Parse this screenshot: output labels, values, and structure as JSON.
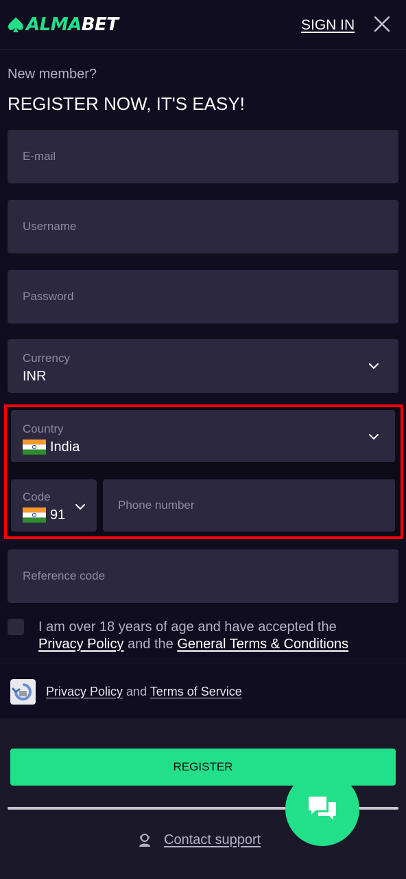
{
  "header": {
    "logo_part1": "ALMA",
    "logo_part2": "BET",
    "signin_label": "SIGN IN",
    "close_icon": "close-icon"
  },
  "intro": {
    "new_member": "New member?",
    "headline": "REGISTER NOW, IT'S EASY!"
  },
  "form": {
    "email_placeholder": "E-mail",
    "username_placeholder": "Username",
    "password_placeholder": "Password",
    "currency_label": "Currency",
    "currency_value": "INR",
    "country_label": "Country",
    "country_value": "India",
    "code_label": "Code",
    "code_value": "91",
    "phone_placeholder": "Phone number",
    "reference_placeholder": "Reference code"
  },
  "consent": {
    "text_line1": "I am over 18 years of age and have accepted the",
    "privacy_link": "Privacy Policy",
    "and_the": "and the",
    "terms_link": "General Terms & Conditions"
  },
  "recaptcha": {
    "privacy_link": "Privacy Policy",
    "and": "and",
    "terms_link": "Terms of Service"
  },
  "footer": {
    "register_label": "REGISTER",
    "contact_support": "Contact support"
  },
  "colors": {
    "accent": "#22e08a",
    "background": "#0f0d1f",
    "field": "#2b2840",
    "highlight_border": "#ff0000"
  }
}
